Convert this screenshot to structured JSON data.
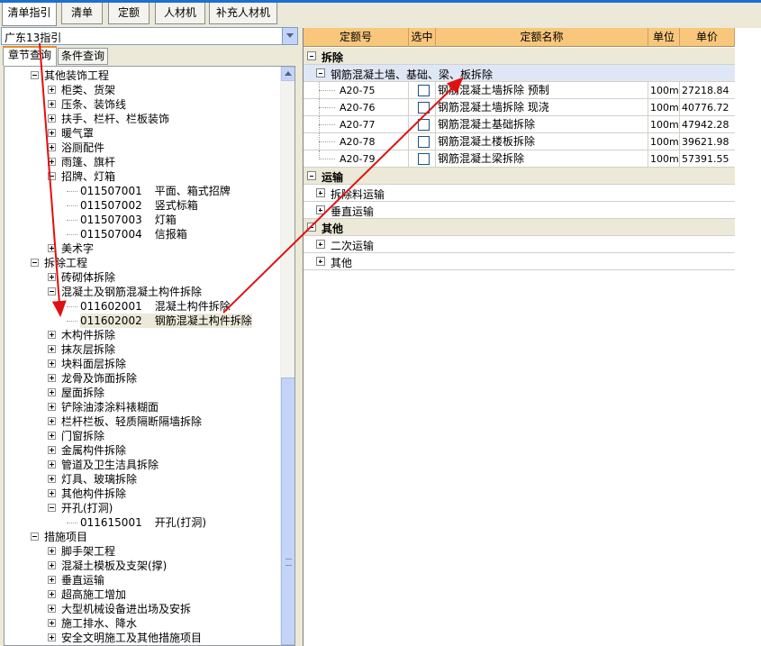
{
  "top_tabs": [
    "清单指引",
    "清单",
    "定额",
    "人材机",
    "补充人材机"
  ],
  "combo": {
    "value": "广东13指引"
  },
  "sub_tabs": [
    "章节查询",
    "条件查询"
  ],
  "tree": [
    {
      "label": "其他装饰工程"
    },
    {
      "label": "柜类、货架"
    },
    {
      "label": "压条、装饰线"
    },
    {
      "label": "扶手、栏杆、栏板装饰"
    },
    {
      "label": "暖气罩"
    },
    {
      "label": "浴厕配件"
    },
    {
      "label": "雨篷、旗杆"
    },
    {
      "label": "招牌、灯箱"
    },
    {
      "code": "011507001",
      "label": "平面、箱式招牌"
    },
    {
      "code": "011507002",
      "label": "竖式标箱"
    },
    {
      "code": "011507003",
      "label": "灯箱"
    },
    {
      "code": "011507004",
      "label": "信报箱"
    },
    {
      "label": "美术字"
    },
    {
      "label": "拆除工程"
    },
    {
      "label": "砖砌体拆除"
    },
    {
      "label": "混凝土及钢筋混凝土构件拆除"
    },
    {
      "code": "011602001",
      "label": "混凝土构件拆除"
    },
    {
      "code": "011602002",
      "label": "钢筋混凝土构件拆除"
    },
    {
      "label": "木构件拆除"
    },
    {
      "label": "抹灰层拆除"
    },
    {
      "label": "块料面层拆除"
    },
    {
      "label": "龙骨及饰面拆除"
    },
    {
      "label": "屋面拆除"
    },
    {
      "label": "铲除油漆涂料裱糊面"
    },
    {
      "label": "栏杆栏板、轻质隔断隔墙拆除"
    },
    {
      "label": "门窗拆除"
    },
    {
      "label": "金属构件拆除"
    },
    {
      "label": "管道及卫生洁具拆除"
    },
    {
      "label": "灯具、玻璃拆除"
    },
    {
      "label": "其他构件拆除"
    },
    {
      "label": "开孔(打洞)"
    },
    {
      "code": "011615001",
      "label": "开孔(打洞)"
    },
    {
      "label": "措施项目"
    },
    {
      "label": "脚手架工程"
    },
    {
      "label": "混凝土模板及支架(撑)"
    },
    {
      "label": "垂直运输"
    },
    {
      "label": "超高施工增加"
    },
    {
      "label": "大型机械设备进出场及安拆"
    },
    {
      "label": "施工排水、降水"
    },
    {
      "label": "安全文明施工及其他措施项目"
    }
  ],
  "grid": {
    "headers": [
      "定额号",
      "选中",
      "定额名称",
      "单位",
      "单价"
    ],
    "groups": [
      {
        "label": "拆除",
        "subs": [
          {
            "label": "钢筋混凝土墙、基础、梁、板拆除",
            "rows": [
              {
                "code": "A20-75",
                "name": "钢筋混凝土墙拆除 预制",
                "unit": "100m3",
                "price": "27218.84"
              },
              {
                "code": "A20-76",
                "name": "钢筋混凝土墙拆除 现浇",
                "unit": "100m3",
                "price": "40776.72"
              },
              {
                "code": "A20-77",
                "name": "钢筋混凝土基础拆除",
                "unit": "100m3",
                "price": "47942.28"
              },
              {
                "code": "A20-78",
                "name": "钢筋混凝土楼板拆除",
                "unit": "100m3",
                "price": "39621.98"
              },
              {
                "code": "A20-79",
                "name": "钢筋混凝土梁拆除",
                "unit": "100m3",
                "price": "57391.55"
              }
            ]
          }
        ]
      },
      {
        "label": "运输",
        "subs": [
          {
            "label": "拆除料运输",
            "rows": []
          },
          {
            "label": "垂直运输",
            "rows": []
          }
        ]
      },
      {
        "label": "其他",
        "subs": [
          {
            "label": "二次运输",
            "rows": []
          },
          {
            "label": "其他",
            "rows": []
          }
        ]
      }
    ]
  },
  "colors": {
    "accent": "#1d6fd1",
    "header": "#f9c77c",
    "arrow": "#e01010"
  }
}
